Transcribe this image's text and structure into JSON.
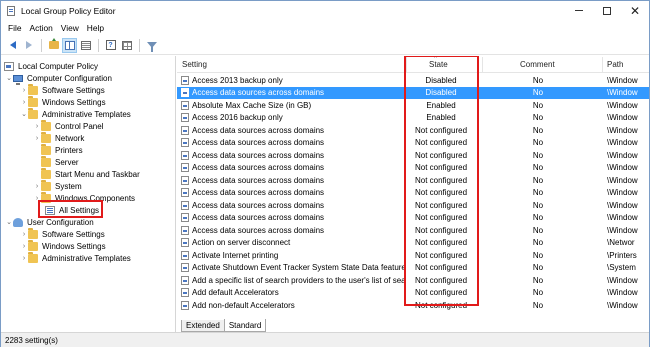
{
  "window": {
    "title": "Local Group Policy Editor"
  },
  "menu": [
    {
      "label": "File"
    },
    {
      "label": "Action"
    },
    {
      "label": "View"
    },
    {
      "label": "Help"
    }
  ],
  "tree": {
    "root": "Local Computer Policy",
    "computer_config": "Computer Configuration",
    "software_settings_1": "Software Settings",
    "windows_settings_1": "Windows Settings",
    "admin_templates_1": "Administrative Templates",
    "control_panel": "Control Panel",
    "network": "Network",
    "printers": "Printers",
    "server": "Server",
    "start_menu": "Start Menu and Taskbar",
    "system": "System",
    "windows_components": "Windows Components",
    "all_settings": "All Settings",
    "user_config": "User Configuration",
    "software_settings_2": "Software Settings",
    "windows_settings_2": "Windows Settings",
    "admin_templates_2": "Administrative Templates"
  },
  "table": {
    "columns": {
      "setting": "Setting",
      "state": "State",
      "comment": "Comment",
      "path": "Path"
    },
    "rows": [
      {
        "setting": "Access 2013 backup only",
        "state": "Disabled",
        "comment": "No",
        "path": "\\Window"
      },
      {
        "setting": "Access data sources across domains",
        "state": "Disabled",
        "comment": "No",
        "path": "\\Window",
        "selected": true
      },
      {
        "setting": "Absolute Max Cache Size (in GB)",
        "state": "Enabled",
        "comment": "No",
        "path": "\\Window"
      },
      {
        "setting": "Access 2016 backup only",
        "state": "Enabled",
        "comment": "No",
        "path": "\\Window"
      },
      {
        "setting": "Access data sources across domains",
        "state": "Not configured",
        "comment": "No",
        "path": "\\Window"
      },
      {
        "setting": "Access data sources across domains",
        "state": "Not configured",
        "comment": "No",
        "path": "\\Window"
      },
      {
        "setting": "Access data sources across domains",
        "state": "Not configured",
        "comment": "No",
        "path": "\\Window"
      },
      {
        "setting": "Access data sources across domains",
        "state": "Not configured",
        "comment": "No",
        "path": "\\Window"
      },
      {
        "setting": "Access data sources across domains",
        "state": "Not configured",
        "comment": "No",
        "path": "\\Window"
      },
      {
        "setting": "Access data sources across domains",
        "state": "Not configured",
        "comment": "No",
        "path": "\\Window"
      },
      {
        "setting": "Access data sources across domains",
        "state": "Not configured",
        "comment": "No",
        "path": "\\Window"
      },
      {
        "setting": "Access data sources across domains",
        "state": "Not configured",
        "comment": "No",
        "path": "\\Window"
      },
      {
        "setting": "Access data sources across domains",
        "state": "Not configured",
        "comment": "No",
        "path": "\\Window"
      },
      {
        "setting": "Action on server disconnect",
        "state": "Not configured",
        "comment": "No",
        "path": "\\Networ"
      },
      {
        "setting": "Activate Internet printing",
        "state": "Not configured",
        "comment": "No",
        "path": "\\Printers"
      },
      {
        "setting": "Activate Shutdown Event Tracker System State Data feature",
        "state": "Not configured",
        "comment": "No",
        "path": "\\System"
      },
      {
        "setting": "Add a specific list of search providers to the user's list of sea...",
        "state": "Not configured",
        "comment": "No",
        "path": "\\Window"
      },
      {
        "setting": "Add default Accelerators",
        "state": "Not configured",
        "comment": "No",
        "path": "\\Window"
      },
      {
        "setting": "Add non-default Accelerators",
        "state": "Not configured",
        "comment": "No",
        "path": "\\Window"
      }
    ]
  },
  "tabs": [
    {
      "label": "Extended"
    },
    {
      "label": "Standard"
    }
  ],
  "status": {
    "text": "2283 setting(s)"
  },
  "colors": {
    "selection": "#3399ff",
    "highlight_box": "#e11a1a",
    "folder": "#f0c453"
  }
}
